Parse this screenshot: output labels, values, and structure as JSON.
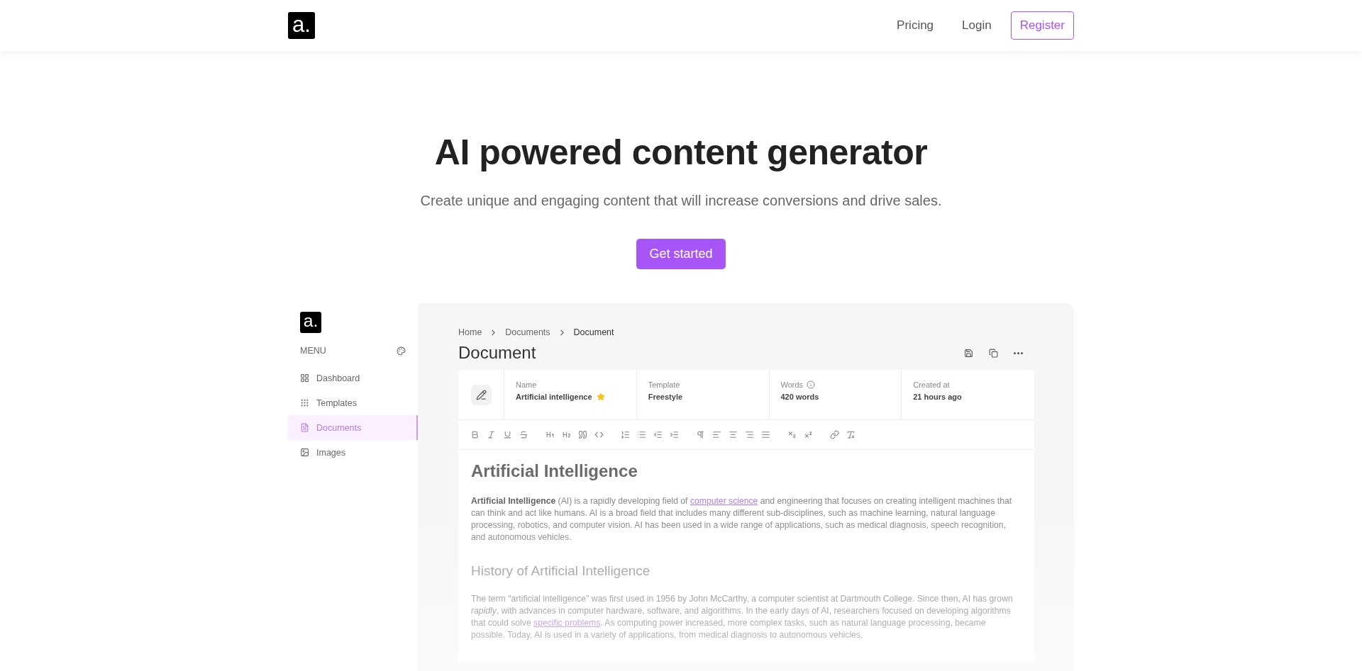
{
  "header": {
    "logo": "a.",
    "nav": [
      {
        "label": "Pricing",
        "kind": "link"
      },
      {
        "label": "Login",
        "kind": "link"
      },
      {
        "label": "Register",
        "kind": "outline"
      }
    ]
  },
  "hero": {
    "title": "AI powered content generator",
    "subtitle": "Create unique and engaging content that will increase conversions and drive sales.",
    "cta": "Get started"
  },
  "preview": {
    "sidebar": {
      "logo": "a.",
      "menu_label": "MENU",
      "items": [
        {
          "label": "Dashboard",
          "selected": false
        },
        {
          "label": "Templates",
          "selected": false
        },
        {
          "label": "Documents",
          "selected": true
        },
        {
          "label": "Images",
          "selected": false
        }
      ]
    },
    "breadcrumb": [
      "Home",
      "Documents",
      "Document"
    ],
    "title": "Document",
    "info": [
      {
        "label": "Name",
        "value": "Artificial intelligence",
        "starred": true,
        "info": false
      },
      {
        "label": "Template",
        "value": "Freestyle",
        "starred": false,
        "info": false
      },
      {
        "label": "Words",
        "value": "420 words",
        "starred": false,
        "info": true
      },
      {
        "label": "Created at",
        "value": "21 hours ago",
        "starred": false,
        "info": false
      }
    ],
    "document": [
      {
        "kind": "h1",
        "text": "Artificial Intelligence"
      },
      {
        "kind": "p",
        "before": "**Artificial Intelligence** (AI) is a rapidly developing field of ",
        "link": "computer science",
        "after": " and engineering that focuses on creating intelligent machines that can think and act like humans. AI is a broad field that includes many different sub-disciplines, such as machine learning, natural language processing, robotics, and computer vision. AI has been used in a wide range of applications, such as medical diagnosis, speech recognition, and autonomous vehicles."
      },
      {
        "kind": "h2",
        "text": "History of Artificial Intelligence"
      },
      {
        "kind": "p",
        "before": "The term \"artificial intelligence\" was first used in 1956 by John McCarthy, a computer scientist at Dartmouth College. Since then, AI has grown *rapidly*, with advances in computer hardware, software, and algorithms. In the early days of AI, researchers focused on developing algorithms that could solve ",
        "link": "specific problems",
        "after": ". As computing power increased, more complex tasks, such as natural language processing, became possible. Today, AI is used in a variety of applications, from medical diagnosis to autonomous vehicles."
      }
    ]
  }
}
